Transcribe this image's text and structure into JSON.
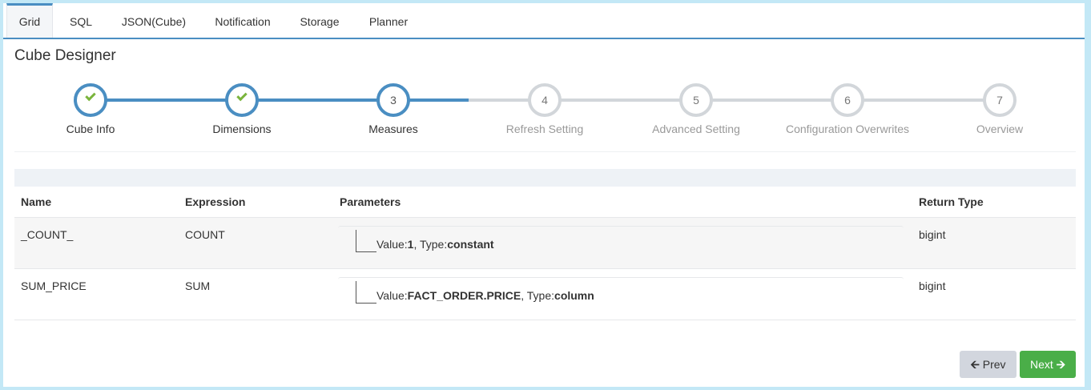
{
  "tabs": [
    {
      "label": "Grid",
      "active": true
    },
    {
      "label": "SQL"
    },
    {
      "label": "JSON(Cube)"
    },
    {
      "label": "Notification"
    },
    {
      "label": "Storage"
    },
    {
      "label": "Planner"
    }
  ],
  "page_title": "Cube Designer",
  "wizard": {
    "steps": [
      {
        "num": "1",
        "label": "Cube Info",
        "state": "done"
      },
      {
        "num": "2",
        "label": "Dimensions",
        "state": "done"
      },
      {
        "num": "3",
        "label": "Measures",
        "state": "current"
      },
      {
        "num": "4",
        "label": "Refresh Setting",
        "state": "todo"
      },
      {
        "num": "5",
        "label": "Advanced Setting",
        "state": "todo"
      },
      {
        "num": "6",
        "label": "Configuration Overwrites",
        "state": "todo"
      },
      {
        "num": "7",
        "label": "Overview",
        "state": "todo"
      }
    ]
  },
  "table": {
    "headers": {
      "name": "Name",
      "expression": "Expression",
      "parameters": "Parameters",
      "return_type": "Return Type"
    },
    "rows": [
      {
        "name": "_COUNT_",
        "expression": "COUNT",
        "param_value_label": "Value:",
        "param_value": "1",
        "param_type_label": ", Type:",
        "param_type": "constant",
        "return_type": "bigint"
      },
      {
        "name": "SUM_PRICE",
        "expression": "SUM",
        "param_value_label": "Value:",
        "param_value": "FACT_ORDER.PRICE",
        "param_type_label": ", Type:",
        "param_type": "column",
        "return_type": "bigint"
      }
    ]
  },
  "buttons": {
    "prev": "Prev",
    "next": "Next"
  },
  "colors": {
    "accent": "#4a8ec2",
    "check": "#7ab43c",
    "next_button": "#4aae48",
    "prev_button": "#d2d6de"
  }
}
